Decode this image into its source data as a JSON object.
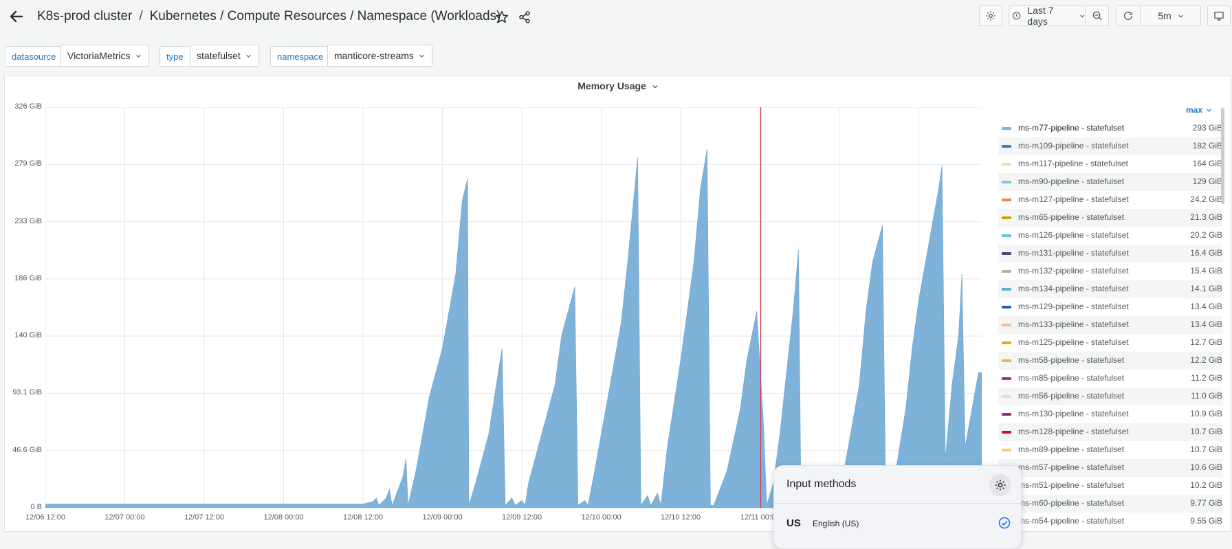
{
  "header": {
    "breadcrumb_root": "K8s-prod cluster",
    "breadcrumb_separator": "/",
    "breadcrumb_title": "Kubernetes / Compute Resources / Namespace (Workloads)",
    "time_range": "Last 7 days",
    "refresh_interval": "5m"
  },
  "variables": {
    "datasource_label": "datasource",
    "datasource_value": "VictoriaMetrics",
    "type_label": "type",
    "type_value": "statefulset",
    "namespace_label": "namespace",
    "namespace_value": "manticore-streams"
  },
  "panel": {
    "title": "Memory Usage"
  },
  "chart_data": {
    "type": "area",
    "title": "Memory Usage",
    "ylabel": "",
    "xlabel": "",
    "y_ticks": [
      "0 B",
      "46.6 GiB",
      "93.1 GiB",
      "140 GiB",
      "186 GiB",
      "233 GiB",
      "279 GiB",
      "326 GiB"
    ],
    "ylim": [
      0,
      326
    ],
    "y_unit": "GiB",
    "x_ticks": [
      "12/06 12:00",
      "12/07 00:00",
      "12/07 12:00",
      "12/08 00:00",
      "12/08 12:00",
      "12/09 00:00",
      "12/09 12:00",
      "12/10 00:00",
      "12/10 12:00",
      "12/11 00:00",
      "12/11 12:00",
      "12/1"
    ],
    "xlim_hours": [
      0,
      141.5
    ],
    "grid": true,
    "cursor_x_hours": 108.1,
    "color": "#7eb2d9",
    "series_name": "ms-m77-pipeline - statefulset",
    "points": [
      [
        0,
        3
      ],
      [
        48,
        3
      ],
      [
        49.5,
        5
      ],
      [
        50,
        8
      ],
      [
        50.4,
        2
      ],
      [
        51.5,
        8
      ],
      [
        52,
        15
      ],
      [
        52.4,
        2
      ],
      [
        54,
        25
      ],
      [
        54.5,
        40
      ],
      [
        54.8,
        2
      ],
      [
        56,
        30
      ],
      [
        57,
        60
      ],
      [
        58,
        90
      ],
      [
        59,
        110
      ],
      [
        60,
        130
      ],
      [
        61,
        160
      ],
      [
        62,
        190
      ],
      [
        62.5,
        220
      ],
      [
        63,
        250
      ],
      [
        63.8,
        268
      ],
      [
        64,
        2
      ],
      [
        65,
        20
      ],
      [
        67,
        60
      ],
      [
        68,
        95
      ],
      [
        69,
        130
      ],
      [
        69.5,
        2
      ],
      [
        70.5,
        8
      ],
      [
        71,
        2
      ],
      [
        72,
        6
      ],
      [
        72.5,
        2
      ],
      [
        73,
        20
      ],
      [
        75,
        60
      ],
      [
        77,
        100
      ],
      [
        78,
        140
      ],
      [
        79,
        160
      ],
      [
        80,
        180
      ],
      [
        80.5,
        2
      ],
      [
        81.5,
        6
      ],
      [
        82,
        2
      ],
      [
        83,
        30
      ],
      [
        85,
        90
      ],
      [
        87,
        150
      ],
      [
        88,
        200
      ],
      [
        89.5,
        285
      ],
      [
        90,
        2
      ],
      [
        91,
        10
      ],
      [
        91.5,
        2
      ],
      [
        92.5,
        12
      ],
      [
        93,
        2
      ],
      [
        94,
        50
      ],
      [
        96,
        120
      ],
      [
        97,
        160
      ],
      [
        98,
        200
      ],
      [
        99,
        260
      ],
      [
        100,
        292
      ],
      [
        100.5,
        2
      ],
      [
        101,
        2
      ],
      [
        103,
        30
      ],
      [
        105,
        80
      ],
      [
        106,
        120
      ],
      [
        107.5,
        160
      ],
      [
        108.5,
        70
      ],
      [
        109,
        2
      ],
      [
        110,
        20
      ],
      [
        111,
        60
      ],
      [
        112,
        110
      ],
      [
        113,
        160
      ],
      [
        113.8,
        210
      ],
      [
        114.2,
        2
      ],
      [
        115,
        10
      ],
      [
        115.5,
        2
      ],
      [
        116.5,
        10
      ],
      [
        117,
        2
      ],
      [
        117.5,
        25
      ],
      [
        118,
        2
      ],
      [
        120,
        10
      ],
      [
        121,
        40
      ],
      [
        123,
        100
      ],
      [
        124,
        160
      ],
      [
        125,
        200
      ],
      [
        126.5,
        230
      ],
      [
        127,
        2
      ],
      [
        128.5,
        30
      ],
      [
        130,
        80
      ],
      [
        131,
        130
      ],
      [
        132,
        170
      ],
      [
        133,
        200
      ],
      [
        134,
        230
      ],
      [
        135,
        260
      ],
      [
        135.5,
        279
      ],
      [
        136,
        40
      ],
      [
        137,
        100
      ],
      [
        138,
        140
      ],
      [
        138.5,
        190
      ],
      [
        139,
        50
      ],
      [
        140,
        80
      ],
      [
        141,
        110
      ],
      [
        141.5,
        110
      ]
    ]
  },
  "legend": {
    "header": "max",
    "items": [
      {
        "name": "ms-m77-pipeline - statefulset",
        "value": "293 GiB",
        "color": "#7eb2d9"
      },
      {
        "name": "ms-m109-pipeline - statefulset",
        "value": "182 GiB",
        "color": "#447ebc"
      },
      {
        "name": "ms-m117-pipeline - statefulset",
        "value": "164 GiB",
        "color": "#f9d9a1"
      },
      {
        "name": "ms-m90-pipeline - statefulset",
        "value": "129 GiB",
        "color": "#6ed0e0"
      },
      {
        "name": "ms-m127-pipeline - statefulset",
        "value": "24.2 GiB",
        "color": "#ef843c"
      },
      {
        "name": "ms-m65-pipeline - statefulset",
        "value": "21.3 GiB",
        "color": "#cca300"
      },
      {
        "name": "ms-m126-pipeline - statefulset",
        "value": "20.2 GiB",
        "color": "#65c5db"
      },
      {
        "name": "ms-m131-pipeline - statefulset",
        "value": "16.4 GiB",
        "color": "#584477"
      },
      {
        "name": "ms-m132-pipeline - statefulset",
        "value": "15.4 GiB",
        "color": "#9ac48a"
      },
      {
        "name": "ms-m134-pipeline - statefulset",
        "value": "14.1 GiB",
        "color": "#64b0c8"
      },
      {
        "name": "ms-m129-pipeline - statefulset",
        "value": "13.4 GiB",
        "color": "#1f60c4"
      },
      {
        "name": "ms-m133-pipeline - statefulset",
        "value": "13.4 GiB",
        "color": "#f9ba8f"
      },
      {
        "name": "ms-m125-pipeline - statefulset",
        "value": "12.7 GiB",
        "color": "#e5ac0e"
      },
      {
        "name": "ms-m58-pipeline - statefulset",
        "value": "12.2 GiB",
        "color": "#eab839"
      },
      {
        "name": "ms-m85-pipeline - statefulset",
        "value": "11.2 GiB",
        "color": "#a0388f"
      },
      {
        "name": "ms-m56-pipeline - statefulset",
        "value": "11.0 GiB",
        "color": "#dedaf7"
      },
      {
        "name": "ms-m130-pipeline - statefulset",
        "value": "10.9 GiB",
        "color": "#962d82"
      },
      {
        "name": "ms-m128-pipeline - statefulset",
        "value": "10.7 GiB",
        "color": "#c4162a"
      },
      {
        "name": "ms-m89-pipeline - statefulset",
        "value": "10.7 GiB",
        "color": "#f9c96e"
      },
      {
        "name": "ms-m57-pipeline - statefulset",
        "value": "10.6 GiB",
        "color": "#6d1f62"
      },
      {
        "name": "ms-m51-pipeline - statefulset",
        "value": "10.2 GiB",
        "color": "#82b5d8"
      },
      {
        "name": "ms-m60-pipeline - statefulset",
        "value": "9.77 GiB",
        "color": "#e0752d"
      },
      {
        "name": "ms-m54-pipeline - statefulset",
        "value": "9.55 GiB",
        "color": "#629e51"
      }
    ]
  },
  "popup": {
    "title": "Input methods",
    "code": "US",
    "language": "English (US)"
  },
  "colors": {
    "accent": "#1f78c1",
    "cursor": "#e02f44"
  }
}
